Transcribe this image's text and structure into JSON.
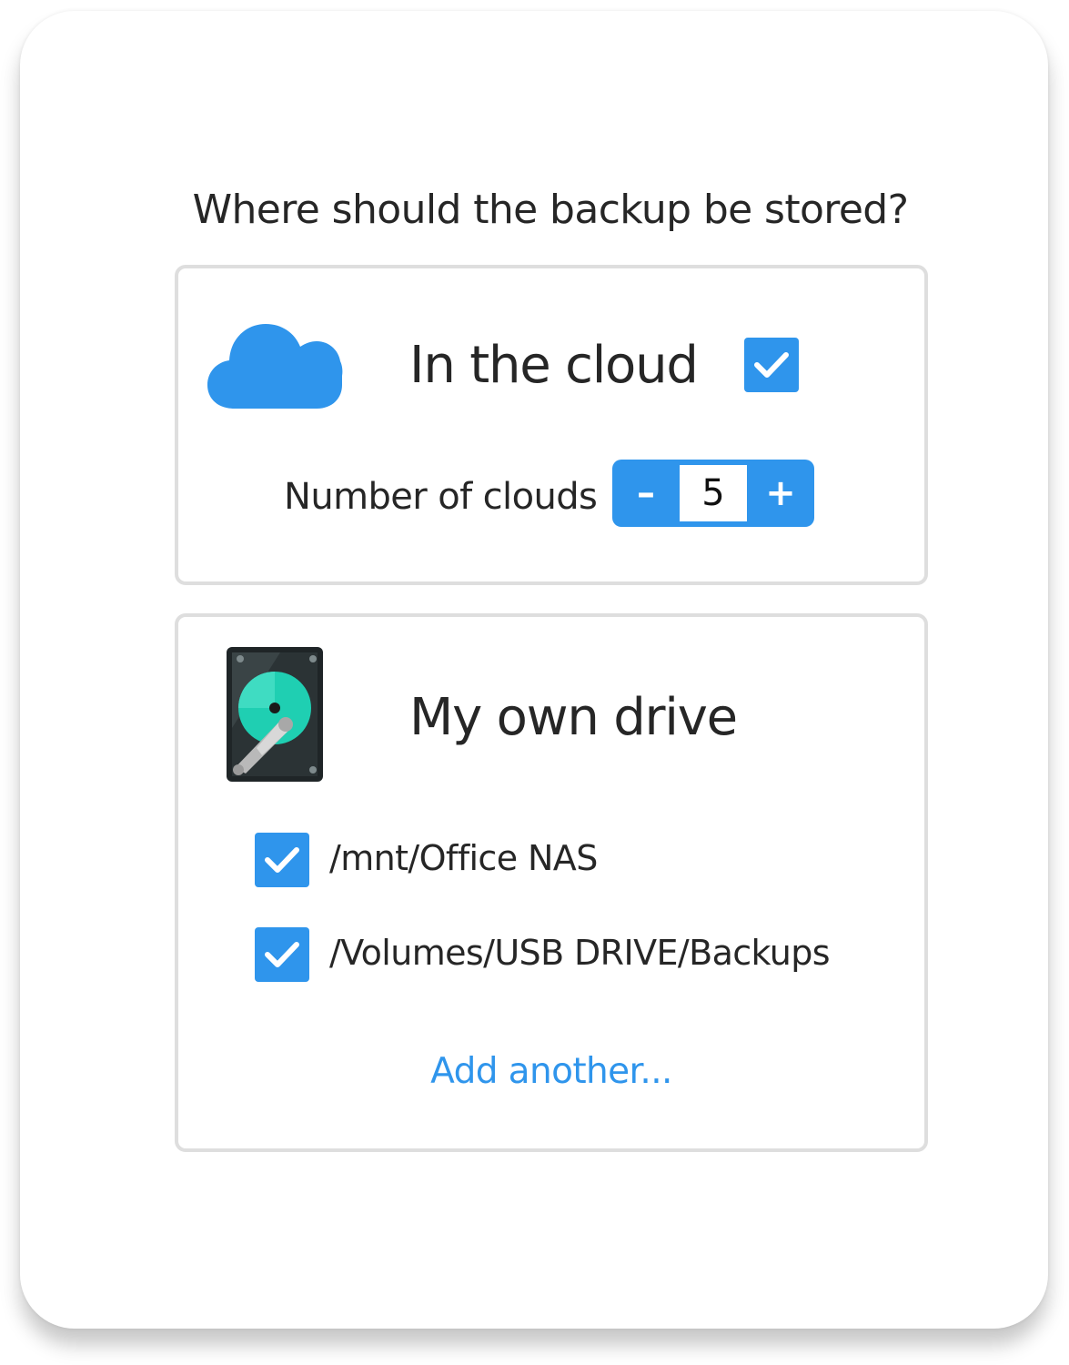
{
  "question": "Where should the backup be stored?",
  "cloud_option": {
    "title": "In the cloud",
    "checked": true,
    "icon": "cloud-icon",
    "stepper": {
      "label": "Number of clouds",
      "decrement": "–",
      "value": "5",
      "increment": "+"
    }
  },
  "drive_option": {
    "title": "My own drive",
    "icon": "hard-drive-icon",
    "paths": [
      {
        "label": "/mnt/Office NAS",
        "checked": true
      },
      {
        "label": "/Volumes/USB DRIVE/Backups",
        "checked": true
      }
    ],
    "add_link": "Add another..."
  },
  "colors": {
    "accent": "#2f95ec",
    "border": "#dedede",
    "text": "#262626"
  }
}
